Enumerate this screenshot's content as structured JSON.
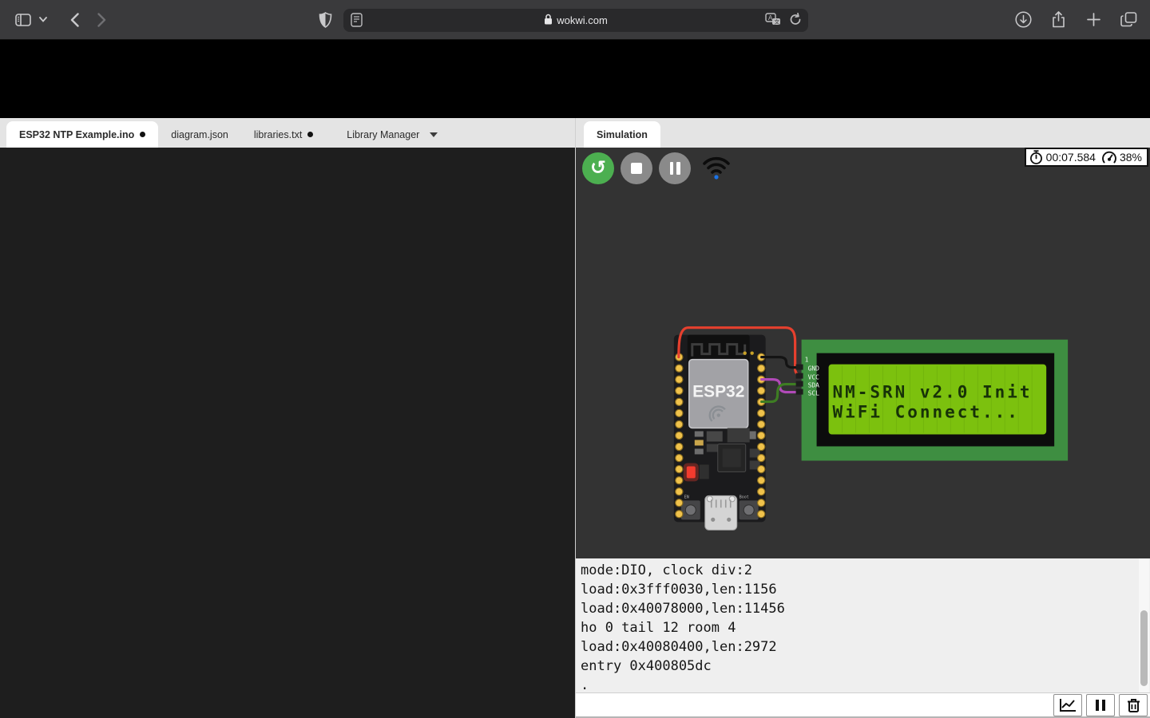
{
  "browser": {
    "url": "wokwi.com"
  },
  "editor": {
    "tabs": [
      {
        "label": "ESP32 NTP Example.ino",
        "modified": true,
        "active": true
      },
      {
        "label": "diagram.json",
        "modified": false,
        "active": false
      },
      {
        "label": "libraries.txt",
        "modified": true,
        "active": false
      },
      {
        "label": "Library Manager",
        "modified": false,
        "active": false,
        "dropdown": true
      }
    ]
  },
  "simulation": {
    "tab_label": "Simulation",
    "timer": "00:07.584",
    "cpu_load": "38%",
    "board": {
      "chip_label": "ESP32",
      "en_button_label": "EN",
      "boot_button_label": "Boot"
    },
    "lcd": {
      "line1": "NM-SRN v2.0 Init",
      "line2": "WiFi Connect...",
      "pin1_label": "1",
      "pins": [
        "GND",
        "VCC",
        "SDA",
        "SCL"
      ]
    }
  },
  "serial": {
    "lines": [
      "mode:DIO, clock div:2",
      "load:0x3fff0030,len:1156",
      "load:0x40078000,len:11456",
      "ho 0 tail 12 room 4",
      "load:0x40080400,len:2972",
      "entry 0x400805dc",
      "."
    ]
  },
  "colors": {
    "accent_green": "#4caf50",
    "wire_red": "#e6402e",
    "wire_black": "#141414",
    "wire_purple": "#b14ab8",
    "wire_green": "#3e7d23",
    "lcd_pcb": "#3e8e41",
    "lcd_screen": "#7cc10e",
    "lcd_text": "#173208",
    "led_red": "#f23b2e"
  }
}
